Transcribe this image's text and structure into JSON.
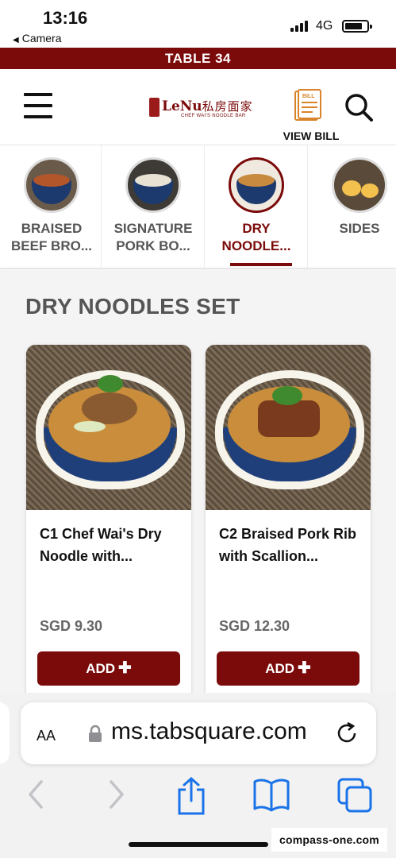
{
  "status_bar": {
    "time": "13:16",
    "back_label": "Camera",
    "network": "4G"
  },
  "table_bar": {
    "label": "TABLE 34"
  },
  "header": {
    "logo_brand": "LeNu",
    "logo_cn": "私房面家",
    "logo_sub": "CHEF WAI'S NOODLE BAR",
    "view_bill_label": "VIEW BILL",
    "icons": {
      "menu": "hamburger-icon",
      "bill": "receipt-icon",
      "search": "search-icon"
    }
  },
  "categories": [
    {
      "label": "BRAISED\nBEEF BRO...",
      "active": false
    },
    {
      "label": "SIGNATURE\nPORK BO...",
      "active": false
    },
    {
      "label": "DRY\nNOODLE...",
      "active": true
    },
    {
      "label": "SIDES",
      "active": false
    }
  ],
  "section": {
    "title": "DRY NOODLES SET"
  },
  "products": [
    {
      "title": "C1 Chef Wai's Dry Noodle with...",
      "price": "SGD 9.30",
      "add_label": "ADD"
    },
    {
      "title": "C2 Braised Pork Rib with Scallion...",
      "price": "SGD 12.30",
      "add_label": "ADD"
    }
  ],
  "browser": {
    "aa_label": "AA",
    "url": "ms.tabsquare.com",
    "icons": [
      "back-icon",
      "forward-icon",
      "share-icon",
      "bookmarks-icon",
      "tabs-icon"
    ]
  },
  "watermark": "compass-one.com",
  "colors": {
    "accent": "#7b0a0a",
    "ios_blue": "#1a73e8"
  }
}
